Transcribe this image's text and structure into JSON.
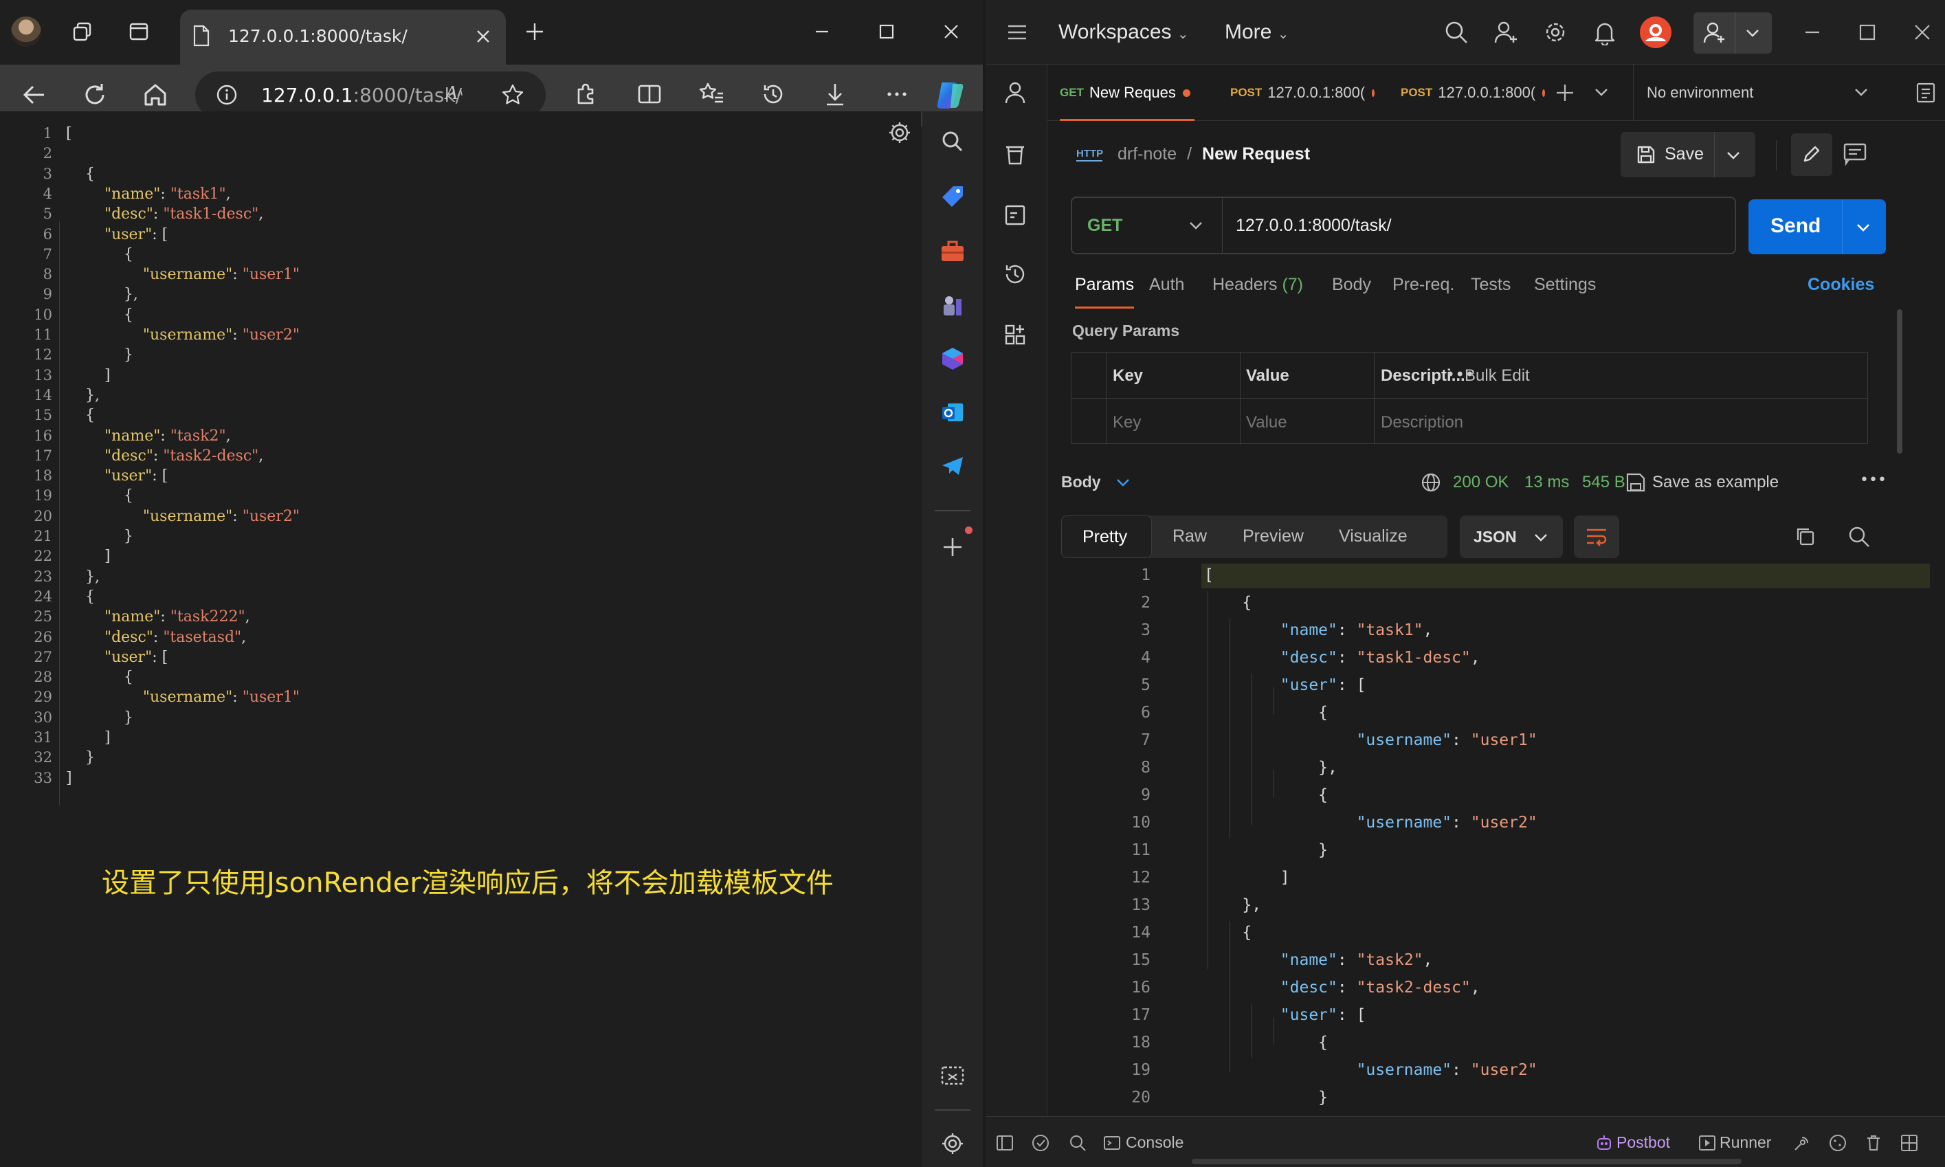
{
  "browser": {
    "tab_title": "127.0.0.1:8000/task/",
    "url_host": "127.0.0.1",
    "url_rest": ":8000/task/",
    "json_lines": [
      [
        {
          "t": "["
        }
      ],
      [],
      [
        {
          "t": "    {"
        }
      ],
      [
        {
          "t": "        "
        },
        {
          "k": "\"name\""
        },
        {
          "t": ": "
        },
        {
          "s": "\"task1\""
        },
        {
          "t": ","
        }
      ],
      [
        {
          "t": "        "
        },
        {
          "k": "\"desc\""
        },
        {
          "t": ": "
        },
        {
          "s": "\"task1-desc\""
        },
        {
          "t": ","
        }
      ],
      [
        {
          "t": "        "
        },
        {
          "k": "\"user\""
        },
        {
          "t": ": ["
        }
      ],
      [
        {
          "t": "            {"
        }
      ],
      [
        {
          "t": "                "
        },
        {
          "k": "\"username\""
        },
        {
          "t": ": "
        },
        {
          "s": "\"user1\""
        }
      ],
      [
        {
          "t": "            },"
        }
      ],
      [
        {
          "t": "            {"
        }
      ],
      [
        {
          "t": "                "
        },
        {
          "k": "\"username\""
        },
        {
          "t": ": "
        },
        {
          "s": "\"user2\""
        }
      ],
      [
        {
          "t": "            }"
        }
      ],
      [
        {
          "t": "        ]"
        }
      ],
      [
        {
          "t": "    },"
        }
      ],
      [
        {
          "t": "    {"
        }
      ],
      [
        {
          "t": "        "
        },
        {
          "k": "\"name\""
        },
        {
          "t": ": "
        },
        {
          "s": "\"task2\""
        },
        {
          "t": ","
        }
      ],
      [
        {
          "t": "        "
        },
        {
          "k": "\"desc\""
        },
        {
          "t": ": "
        },
        {
          "s": "\"task2-desc\""
        },
        {
          "t": ","
        }
      ],
      [
        {
          "t": "        "
        },
        {
          "k": "\"user\""
        },
        {
          "t": ": ["
        }
      ],
      [
        {
          "t": "            {"
        }
      ],
      [
        {
          "t": "                "
        },
        {
          "k": "\"username\""
        },
        {
          "t": ": "
        },
        {
          "s": "\"user2\""
        }
      ],
      [
        {
          "t": "            }"
        }
      ],
      [
        {
          "t": "        ]"
        }
      ],
      [
        {
          "t": "    },"
        }
      ],
      [
        {
          "t": "    {"
        }
      ],
      [
        {
          "t": "        "
        },
        {
          "k": "\"name\""
        },
        {
          "t": ": "
        },
        {
          "s": "\"task222\""
        },
        {
          "t": ","
        }
      ],
      [
        {
          "t": "        "
        },
        {
          "k": "\"desc\""
        },
        {
          "t": ": "
        },
        {
          "s": "\"tasetasd\""
        },
        {
          "t": ","
        }
      ],
      [
        {
          "t": "        "
        },
        {
          "k": "\"user\""
        },
        {
          "t": ": ["
        }
      ],
      [
        {
          "t": "            {"
        }
      ],
      [
        {
          "t": "                "
        },
        {
          "k": "\"username\""
        },
        {
          "t": ": "
        },
        {
          "s": "\"user1\""
        }
      ],
      [
        {
          "t": "            }"
        }
      ],
      [
        {
          "t": "        ]"
        }
      ],
      [
        {
          "t": "    }"
        }
      ],
      [
        {
          "t": "]"
        }
      ]
    ],
    "caption": "设置了只使用JsonRender渲染响应后，将不会加载模板文件"
  },
  "postman": {
    "workspaces_label": "Workspaces",
    "more_label": "More",
    "tabs": [
      {
        "method": "GET",
        "label": "New Reques"
      },
      {
        "method": "POST",
        "label": "127.0.0.1:800("
      },
      {
        "method": "POST",
        "label": "127.0.0.1:800("
      }
    ],
    "environment": "No environment",
    "collection": "drf-note",
    "request_name": "New Request",
    "save_label": "Save",
    "method": "GET",
    "url": "127.0.0.1:8000/task/",
    "send_label": "Send",
    "req_tabs": {
      "params": "Params",
      "auth": "Auth",
      "headers": "Headers",
      "headers_count": "(7)",
      "body": "Body",
      "prereq": "Pre-req.",
      "tests": "Tests",
      "settings": "Settings",
      "cookies": "Cookies"
    },
    "query_params_label": "Query Params",
    "table": {
      "key_header": "Key",
      "value_header": "Value",
      "desc_header": "Descripti...",
      "bulk_edit": "Bulk Edit",
      "key_placeholder": "Key",
      "value_placeholder": "Value",
      "desc_placeholder": "Description"
    },
    "response": {
      "body_label": "Body",
      "status": "200 OK",
      "time": "13 ms",
      "size": "545 B",
      "save_example": "Save as example"
    },
    "views": {
      "pretty": "Pretty",
      "raw": "Raw",
      "preview": "Preview",
      "visualize": "Visualize",
      "format": "JSON"
    },
    "resp_lines": [
      [
        {
          "t": "["
        }
      ],
      [
        {
          "t": "    {"
        }
      ],
      [
        {
          "t": "        "
        },
        {
          "k": "\"name\""
        },
        {
          "t": ": "
        },
        {
          "s": "\"task1\""
        },
        {
          "t": ","
        }
      ],
      [
        {
          "t": "        "
        },
        {
          "k": "\"desc\""
        },
        {
          "t": ": "
        },
        {
          "s": "\"task1-desc\""
        },
        {
          "t": ","
        }
      ],
      [
        {
          "t": "        "
        },
        {
          "k": "\"user\""
        },
        {
          "t": ": ["
        }
      ],
      [
        {
          "t": "            {"
        }
      ],
      [
        {
          "t": "                "
        },
        {
          "k": "\"username\""
        },
        {
          "t": ": "
        },
        {
          "s": "\"user1\""
        }
      ],
      [
        {
          "t": "            },"
        }
      ],
      [
        {
          "t": "            {"
        }
      ],
      [
        {
          "t": "                "
        },
        {
          "k": "\"username\""
        },
        {
          "t": ": "
        },
        {
          "s": "\"user2\""
        }
      ],
      [
        {
          "t": "            }"
        }
      ],
      [
        {
          "t": "        ]"
        }
      ],
      [
        {
          "t": "    },"
        }
      ],
      [
        {
          "t": "    {"
        }
      ],
      [
        {
          "t": "        "
        },
        {
          "k": "\"name\""
        },
        {
          "t": ": "
        },
        {
          "s": "\"task2\""
        },
        {
          "t": ","
        }
      ],
      [
        {
          "t": "        "
        },
        {
          "k": "\"desc\""
        },
        {
          "t": ": "
        },
        {
          "s": "\"task2-desc\""
        },
        {
          "t": ","
        }
      ],
      [
        {
          "t": "        "
        },
        {
          "k": "\"user\""
        },
        {
          "t": ": ["
        }
      ],
      [
        {
          "t": "            {"
        }
      ],
      [
        {
          "t": "                "
        },
        {
          "k": "\"username\""
        },
        {
          "t": ": "
        },
        {
          "s": "\"user2\""
        }
      ],
      [
        {
          "t": "            }"
        }
      ],
      [
        {
          "t": "        ]"
        }
      ],
      [
        {
          "t": "    },"
        }
      ]
    ],
    "status_bar": {
      "console": "Console",
      "postbot": "Postbot",
      "runner": "Runner"
    }
  }
}
